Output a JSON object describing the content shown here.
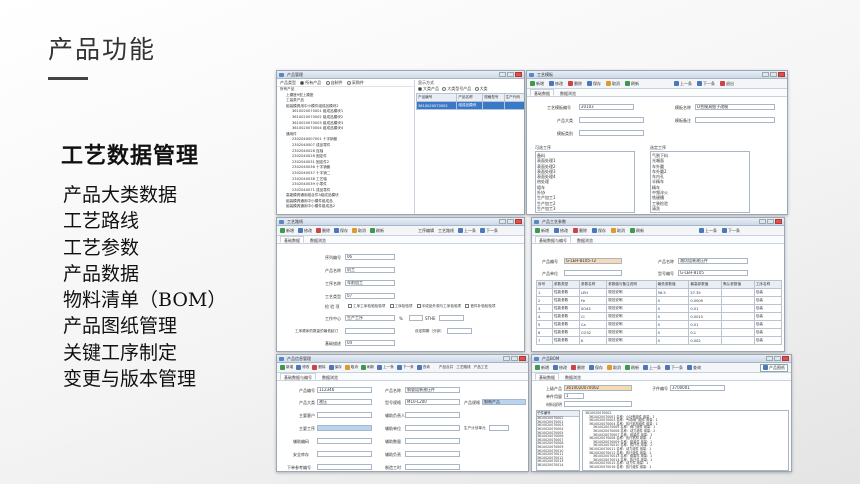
{
  "slide": {
    "title": "产品功能",
    "section_heading": "工艺数据管理",
    "features": [
      "产品大类数据",
      "工艺路线",
      "工艺参数",
      "产品数据",
      "物料清单（BOM）",
      "产品图纸管理",
      "关键工序制定",
      "变更与版本管理"
    ]
  },
  "win1": {
    "title": "产品管理",
    "left_filter_label": "产品类型",
    "left_filters": [
      "所有产品",
      "自制件",
      "采购件"
    ],
    "right_filter_label": "显示方式",
    "right_filters": [
      "大类产品",
      "大类型号产品",
      "大类",
      "大类型号"
    ],
    "tree": [
      "所有产品",
      "上模座9型上模座",
      "工装类产品",
      "组装模具用中小模件组成品模块2",
      "3610020070001 组成品模块1",
      "3610020070002 组成品模块2",
      "3610020070003 组成品模块3",
      "3610020070004 组成品模块4",
      "通用件",
      "2302040007001 十字销套",
      "2302040007 成品零件",
      "2302040026 连轴",
      "2302040028 固定件",
      "2302040031 固定件2",
      "2302040036 十字销套",
      "2302040037 十字销二",
      "2302040038 工艺轴",
      "2302040039 小零件",
      "2302040071 成品零件",
      "高能模具通用组合件3组成品模块",
      "组装模具通用中小模件组成品",
      "组装模具通用中小模件组成品2",
      "组装模具通用两用件模组",
      "组装模具通用中小模件模组",
      "组装模具通用中小模件组件",
      "组装模具通用通用件",
      "组装模具通用件机模",
      "组装模具通用输出模组",
      "整车"
    ],
    "grid_headers": [
      "产品编号",
      "产品名称",
      "规格型号",
      "生产代码",
      "图号"
    ],
    "grid_rows": [
      [
        "3610020070002",
        "组成品模块",
        "",
        "",
        ""
      ],
      [
        "",
        "",
        "",
        "",
        ""
      ],
      [
        "",
        "",
        "",
        "",
        ""
      ]
    ]
  },
  "win2": {
    "title": "工艺模板",
    "toolbar": [
      "新增",
      "修改",
      "删除",
      "保存",
      "取消",
      "刷新",
      "上一条",
      "下一条",
      "退出"
    ],
    "tabs": [
      "基础数据",
      "数据浏览"
    ],
    "template_no_label": "工艺模板编号",
    "template_no_value": "20103",
    "template_name_label": "模板名称",
    "template_name_value": "D合模具胎子改模",
    "product_category_label": "产品大类",
    "template_category_label": "模板类别",
    "template_note_label": "模板备注",
    "available_label": "可选工序",
    "available_items": [
      "备料",
      "表面处理1",
      "表面处理2",
      "表面处理3",
      "表面处理4",
      "热处理",
      "粗车",
      "外协",
      "生产加工1",
      "生产加工2",
      "生产加工3"
    ],
    "selected_label": "选定工序",
    "selected_items": [
      "气割下料",
      "光端面",
      "车外圆",
      "车外圆2",
      "车内孔",
      "半精车",
      "精车",
      "中频淬火",
      "铣键槽",
      "工装检验",
      "清洗",
      "包装",
      "入库"
    ]
  },
  "win3": {
    "title": "工艺路线",
    "toolbar": [
      "新增",
      "修改",
      "删除",
      "保存",
      "取消",
      "刷新",
      "工序编辑",
      "工艺路线",
      "上一条",
      "下一条"
    ],
    "tabs": [
      "基础数据",
      "数据浏览"
    ],
    "fields": [
      {
        "label": "序列编号",
        "value": "06"
      },
      {
        "label": "产品名称",
        "value": "机工"
      },
      {
        "label": "工序名称",
        "value": "车削加工"
      },
      {
        "label": "工艺类型",
        "value": "07"
      }
    ],
    "check_label": "检 验 项",
    "checks": [
      "工序工序检验检验项",
      "工序检验项",
      "半成品外观与工序检验项",
      "首件补验检验项"
    ],
    "work_center_label": "工作中心",
    "work_center_value": "生产工序",
    "pct_label": "%",
    "std_label": "STHE",
    "plan_label": "工序顺序的数量的最低起订",
    "time_label": "设定周期（分钟）",
    "remark_label": "基础描述",
    "remark_value": "04"
  },
  "win4": {
    "title": "产品工艺参数",
    "toolbar": [
      "新增",
      "修改",
      "删除",
      "保存",
      "取消",
      "刷新",
      "上一条",
      "下一条"
    ],
    "tabs": [
      "基础数据与编号",
      "数据浏览"
    ],
    "product_no_label": "产品编号",
    "product_no_value": "G-LEH-8105-T2",
    "product_name_label": "产品名称",
    "product_name_value": "潍坊组装液压件",
    "product_type_label": "产品单位",
    "drawing_label": "型号编号",
    "drawing_value": "G-LEH-8105",
    "grid_headers": [
      "序号",
      "参数类型",
      "参数名称",
      "参数值与备注说明",
      "最低参数值",
      "最高参数值",
      "默认参数值",
      "备注",
      "工序名称"
    ],
    "grid_rows": [
      [
        "1",
        "性能参数",
        "LEH",
        "规范说明",
        "56.5",
        "57.35",
        "",
        "",
        "包装"
      ],
      [
        "2",
        "性能参数",
        "Fe",
        "规范说明",
        "0",
        "0.0009",
        "",
        "",
        "包装"
      ],
      [
        "3",
        "性能参数",
        "SO43",
        "规范说明",
        "0",
        "0.01",
        "",
        "",
        "包装"
      ],
      [
        "4",
        "性能参数",
        "Cl",
        "规范说明",
        "0",
        "0.0015",
        "",
        "",
        "包装"
      ],
      [
        "5",
        "性能参数",
        "Ca",
        "规范说明",
        "0",
        "0.01",
        "",
        "",
        "包装"
      ],
      [
        "6",
        "性能参数",
        "CO32",
        "规范说明",
        "0",
        "0.1",
        "",
        "",
        "包装"
      ],
      [
        "7",
        "性能参数",
        "K",
        "规范说明",
        "0",
        "0.002",
        "",
        "",
        "包装"
      ]
    ]
  },
  "win5": {
    "title": "产品信息管理",
    "toolbar": [
      "新增",
      "修改",
      "删除",
      "保存",
      "取消",
      "刷新",
      "上一条",
      "下一条",
      "查询",
      "产品合并",
      "工艺路线",
      "产品工艺",
      "产品参数",
      "升级版本",
      "退出"
    ],
    "tabs": [
      "基础数据与编号",
      "数据浏览"
    ],
    "rows": [
      {
        "l1": "产品编号",
        "v1": "112346",
        "l2": "产品名称",
        "v2": "钢管组装液压件"
      },
      {
        "l1": "产品大类",
        "v1": "液压",
        "l2": "型号规格",
        "v2": "M10-L200",
        "l3": "产品规格",
        "v3": "钢制产品"
      },
      {
        "l1": "主要客户",
        "v1": "",
        "l2": "辅助负责人",
        "v2": ""
      },
      {
        "l1": "主要工序",
        "v1": "",
        "l2": "辅助单位",
        "v2": "",
        "l3": "生产计划单元",
        "v3": ""
      },
      {
        "l1": "辅助编码",
        "v1": "",
        "l2": "辅助数量",
        "v2": ""
      },
      {
        "l1": "安全库存",
        "v1": "",
        "l2": "辅助负责",
        "v2": ""
      },
      {
        "l1": "下单参考编号",
        "v1": "",
        "l2": "制造工时",
        "v2": ""
      }
    ]
  },
  "win6": {
    "title": "产品BOM",
    "toolbar": [
      "新增",
      "修改",
      "删除",
      "保存",
      "取消",
      "刷新",
      "上一条",
      "下一条",
      "查询"
    ],
    "print_button": "产品图纸",
    "tabs": [
      "基础数据",
      "数据浏览"
    ],
    "parent_label": "上级产品",
    "parent_value": "3610020070002",
    "sub_label": "子件编号",
    "sub_value": "3700001",
    "unit_label": "单件用量",
    "unit_value": "1",
    "material_label": "材料说明",
    "list_header": "子件编号",
    "list_items": [
      "3610020070002",
      "3610020070001",
      "3610020070003",
      "3610020070004",
      "3610020070005",
      "3610020070006",
      "3610020070007",
      "3610020070008",
      "3610020070009",
      "3610020070010",
      "3610020070011",
      "3610020070012",
      "3610020070013",
      "3610020070014",
      "3610020070015",
      "3610020070016"
    ],
    "tree_lines": [
      "3610020070002",
      "  3610020070001 名称：小功率组件 用量：1",
      "  3610020070003 名称：气动阀门组件 用量：1",
      "  3610020070004 名称：执行机构组件 用量：1",
      "    3610020070005 名称：阀门组件 用量：1",
      "    3610020070006 名称：动力组件 用量：2",
      "    3610020070007 名称：组装件 用量：1",
      "  3610020070008 名称：执行机构 用量：1",
      "    3610020070009 名称：组装件 用量：1",
      "    3610020070010 名称：执行件 用量：2",
      "  3610020070011 名称：动力组件 用量：1",
      "  3610020070012 名称：执行组件 用量：1",
      "    3610020070013 名称：组装件 用量：1",
      "    3610020070014 名称：执行件 用量：1",
      "  3610020070015 名称：动力件 用量：1",
      "  3610020070016 名称：执行组件 用量：1",
      "    3610020070017 名称：组装件 用量：1",
      "    3610020070018 名称：组装件 用量：1",
      "  3610020070019 名称：执行件 用量：1"
    ]
  }
}
